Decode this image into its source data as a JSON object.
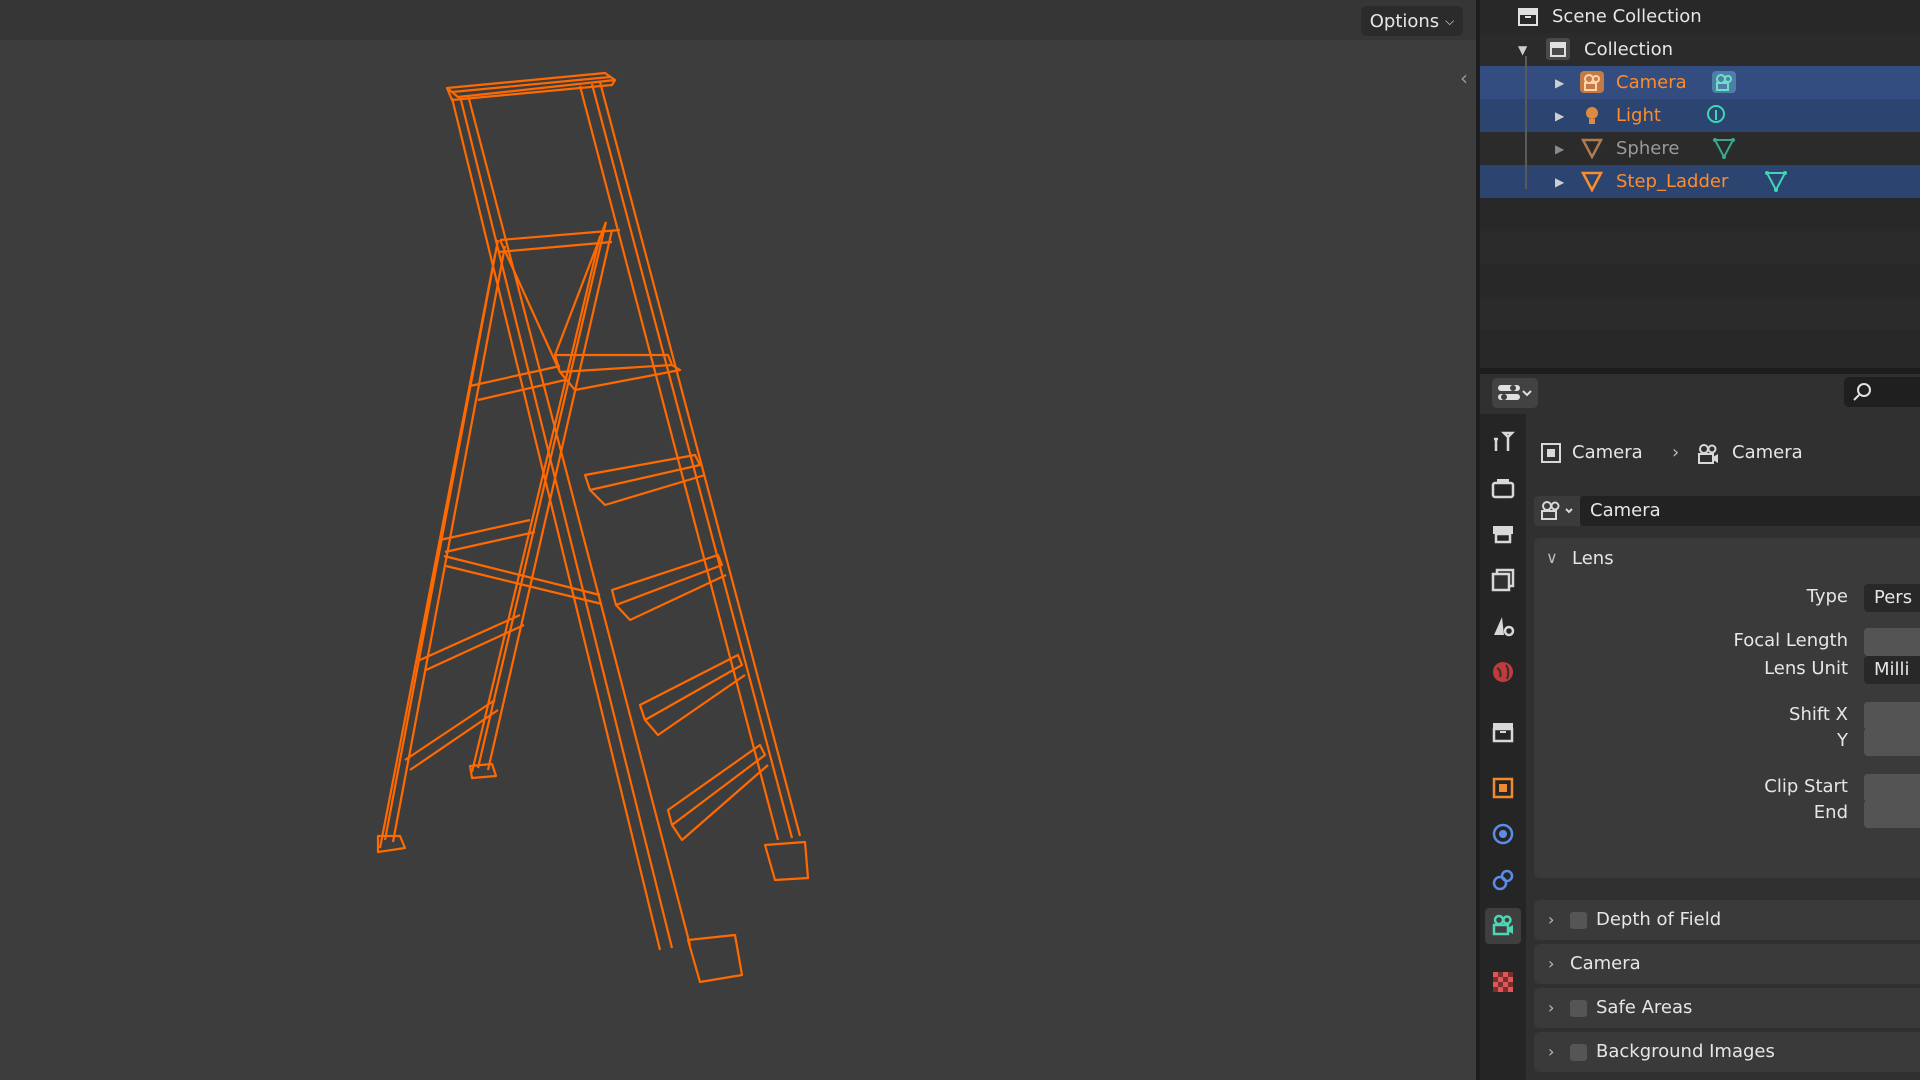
{
  "viewport": {
    "options_label": "Options",
    "wire_color": "#ff6a00"
  },
  "outliner": {
    "scene_collection": "Scene Collection",
    "collection": "Collection",
    "items": [
      {
        "label": "Camera",
        "icon": "camera-object-icon",
        "data_icon": "camera-data-icon",
        "selected": true,
        "color": "#ff8c2b"
      },
      {
        "label": "Light",
        "icon": "light-object-icon",
        "data_icon": "light-data-icon",
        "selected": true,
        "color": "#ff8c2b"
      },
      {
        "label": "Sphere",
        "icon": "mesh-object-icon",
        "data_icon": "mesh-data-icon",
        "selected": false,
        "color": "#9a9a9a"
      },
      {
        "label": "Step_Ladder",
        "icon": "mesh-object-icon",
        "data_icon": "mesh-data-icon",
        "selected": true,
        "color": "#ff8c2b"
      }
    ]
  },
  "properties": {
    "breadcrumb_object": "Camera",
    "breadcrumb_data": "Camera",
    "datablock_name": "Camera",
    "tabs": [
      "tool-tab",
      "render-tab",
      "output-tab",
      "view-layer-tab",
      "scene-tab",
      "world-tab",
      "collection-tab",
      "object-tab",
      "modifiers-tab",
      "physics-tab",
      "camera-data-tab",
      "texture-tab"
    ],
    "lens": {
      "title": "Lens",
      "type_label": "Type",
      "type_value": "Pers",
      "focal_length_label": "Focal Length",
      "lens_unit_label": "Lens Unit",
      "lens_unit_value": "Milli",
      "shift_x_label": "Shift X",
      "shift_y_label": "Y",
      "clip_start_label": "Clip Start",
      "clip_end_label": "End"
    },
    "panels": {
      "dof": "Depth of Field",
      "camera": "Camera",
      "safe_areas": "Safe Areas",
      "background_images": "Background Images"
    }
  }
}
